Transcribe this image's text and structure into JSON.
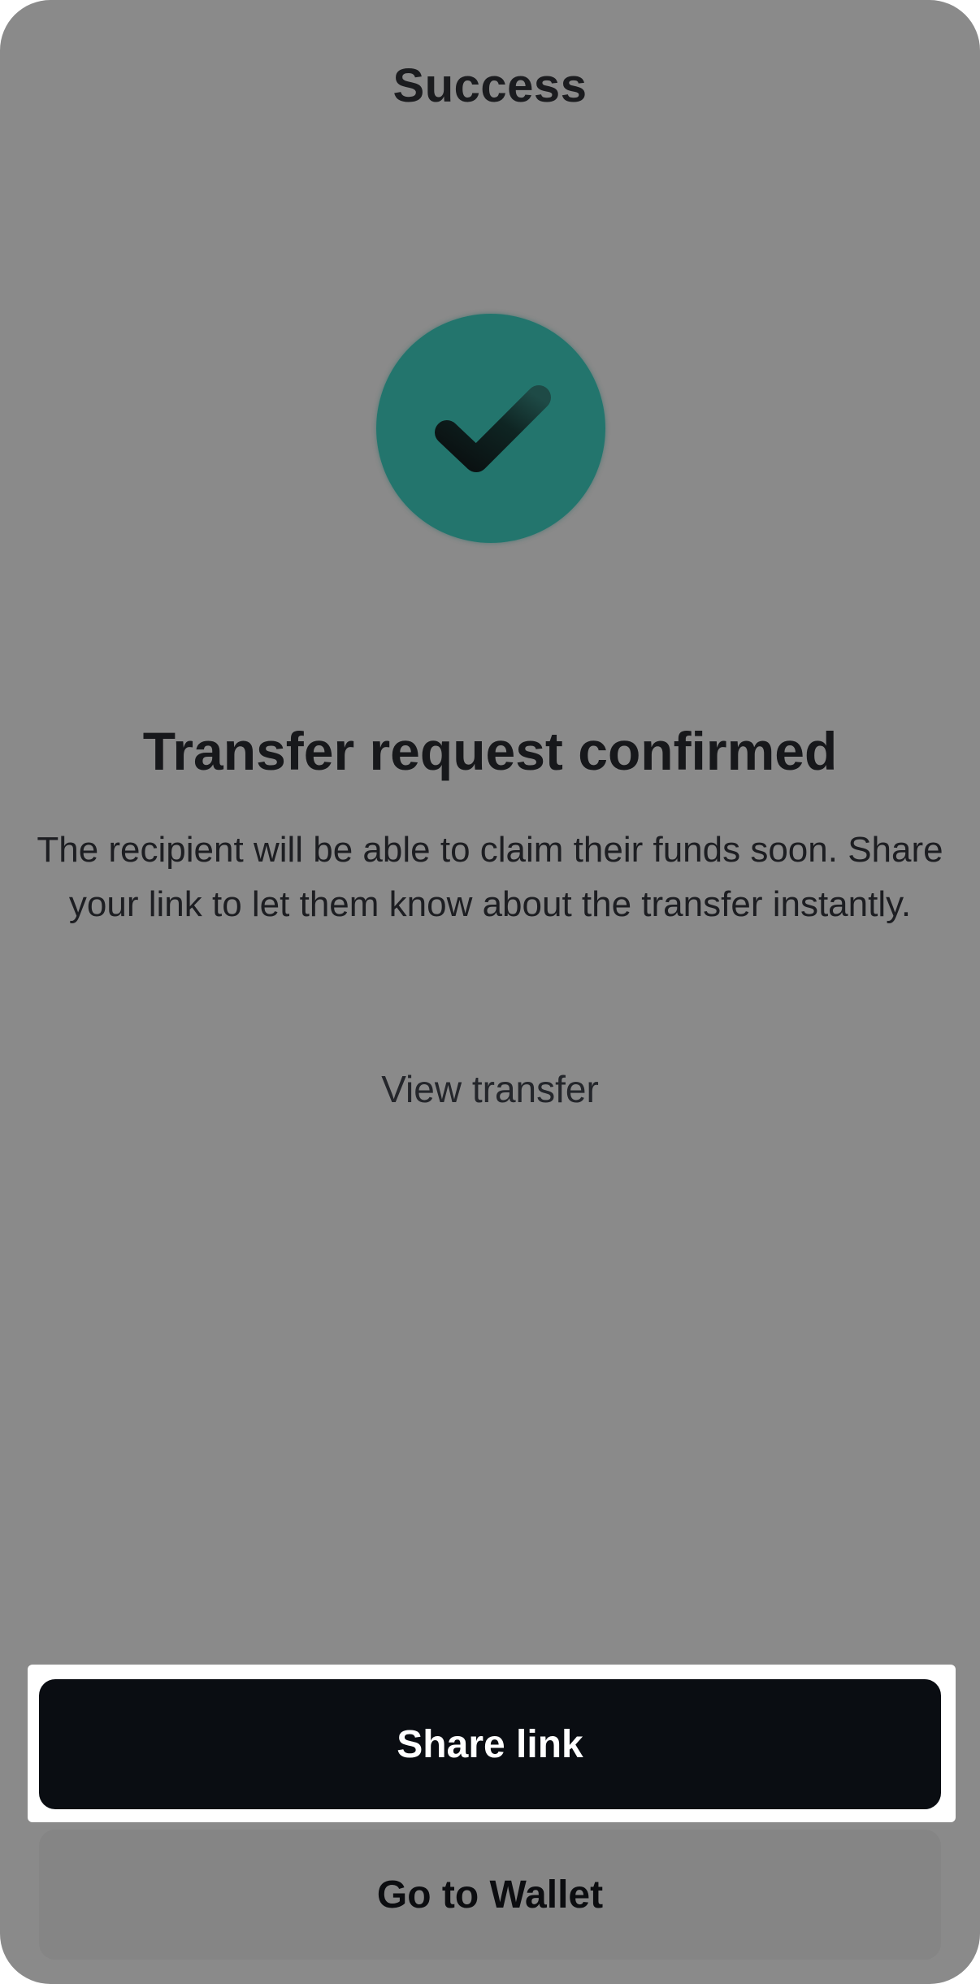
{
  "header": {
    "title": "Success"
  },
  "status": {
    "icon": "checkmark-icon",
    "circle_color": "#23756d"
  },
  "main": {
    "title": "Transfer request confirmed",
    "description": "The recipient will be able to claim their funds soon. Share your link to let them know about the transfer instantly.",
    "view_link_label": "View transfer"
  },
  "actions": {
    "share_label": "Share link",
    "wallet_label": "Go to Wallet"
  },
  "colors": {
    "overlay_background": "#8a8a8a",
    "primary_button": "#0a0d12",
    "secondary_button": "#858585"
  }
}
